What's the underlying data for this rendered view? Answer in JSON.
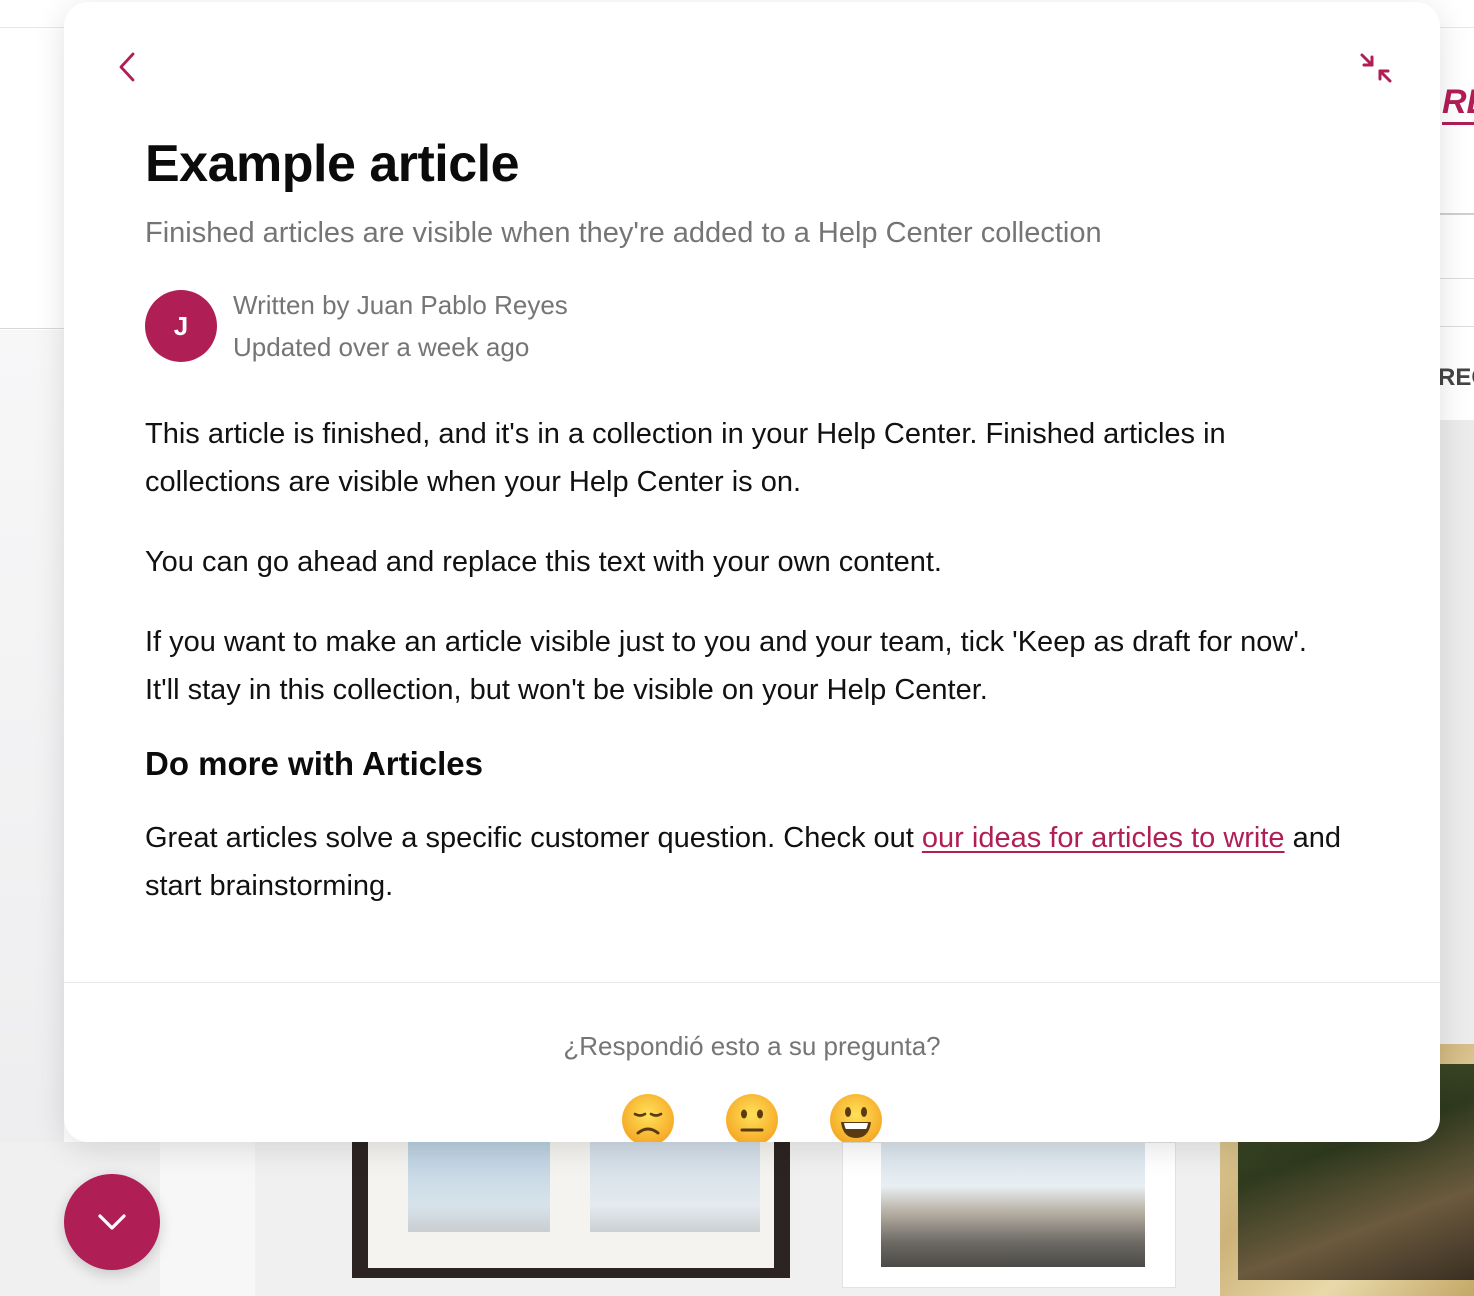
{
  "background": {
    "header_fragment": "RE",
    "sidebar_fragment": "REG"
  },
  "panel": {
    "back_icon": "chevron-left-icon",
    "collapse_icon": "collapse-arrows-icon",
    "article": {
      "title": "Example article",
      "subtitle": "Finished articles are visible when they're added to a Help Center collection",
      "author": {
        "initial": "J",
        "written_by": "Written by Juan Pablo Reyes",
        "updated": "Updated over a week ago"
      },
      "paragraph_1": "This article is finished, and it's in a collection in your Help Center. Finished articles in collections are visible when your Help Center is on.",
      "paragraph_2": "You can go ahead and replace this text with your own content.",
      "paragraph_3": "If you want to make an article visible just to you and your team, tick 'Keep as draft for now'. It'll stay in this collection, but won't be visible on your Help Center.",
      "heading_2": "Do more with Articles",
      "paragraph_4_before": "Great articles solve a specific customer question. Check out ",
      "paragraph_4_link": "our ideas for articles to write",
      "paragraph_4_after": " and start brainstorming."
    },
    "feedback": {
      "question": "¿Respondió esto a su pregunta?",
      "reactions": [
        "disappointed-face",
        "neutral-face",
        "smiling-face"
      ]
    }
  },
  "launcher": {
    "icon": "chevron-down-icon"
  },
  "colors": {
    "accent": "#b01e56",
    "muted_text": "#757575",
    "body_text": "#111111"
  }
}
